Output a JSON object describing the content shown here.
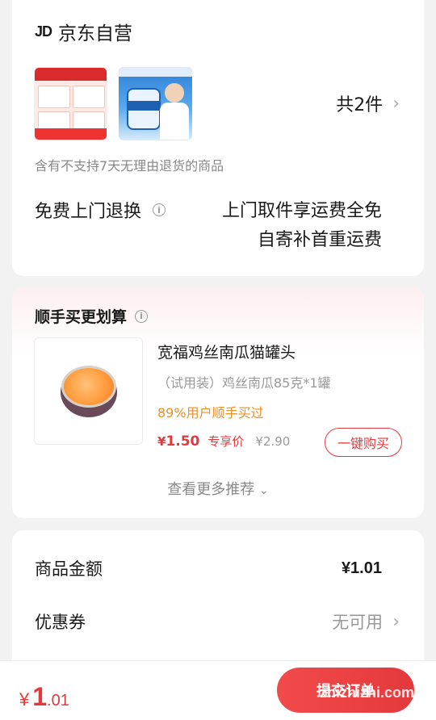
{
  "store": {
    "logo_text": "JD",
    "name": "京东自营"
  },
  "items": {
    "count_text": "共2件"
  },
  "notice": "含有不支持7天无理由退货的商品",
  "returns": {
    "label": "免费上门退换",
    "line1": "上门取件享运费全免",
    "line2": "自寄补首重运费"
  },
  "recommend": {
    "title": "顺手买更划算",
    "product": {
      "name": "宽福鸡丝南瓜猫罐头",
      "spec": "（试用装）鸡丝南瓜85克*1罐",
      "social": "89%用户顺手买过",
      "price_symbol": "¥",
      "price": "1.50",
      "price_tag": "专享价",
      "original_price": "¥2.90",
      "buy_label": "一键购买"
    },
    "more_label": "查看更多推荐"
  },
  "summary": {
    "amount_label": "商品金额",
    "amount_value": "¥1.01",
    "coupon_label": "优惠券",
    "coupon_value": "无可用"
  },
  "footer": {
    "total_symbol": "¥",
    "total_int": "1",
    "total_dec": ".01",
    "submit_label": "提交订单",
    "watermark": "zhizhizhi.com"
  },
  "colors": {
    "accent": "#e4393c",
    "social": "#e8902a",
    "muted": "#999999"
  }
}
